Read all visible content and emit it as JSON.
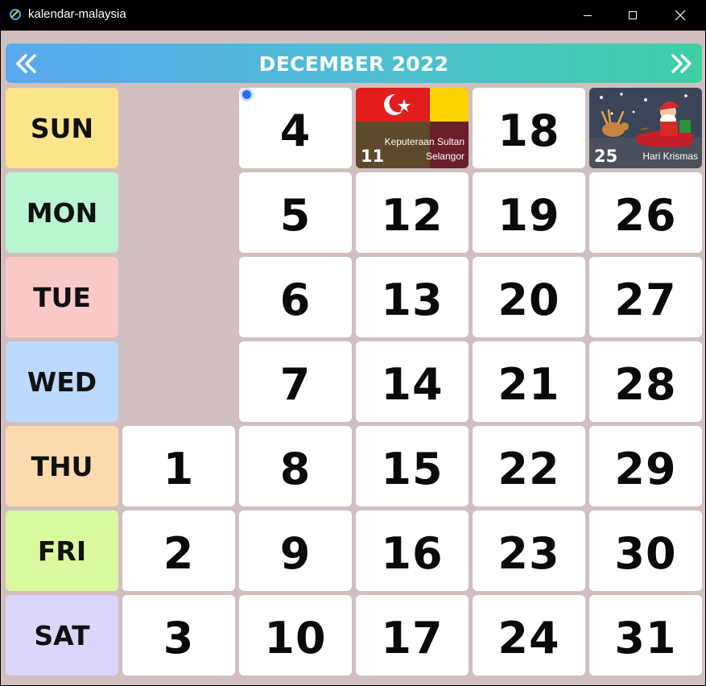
{
  "window": {
    "title": "kalendar-malaysia"
  },
  "header": {
    "month_title": "DECEMBER 2022"
  },
  "days": [
    "SUN",
    "MON",
    "TUE",
    "WED",
    "THU",
    "FRI",
    "SAT"
  ],
  "day_colors": [
    "#fde58c",
    "#b9f5d0",
    "#fcc9c9",
    "#bdd9fd",
    "#fddbae",
    "#daf99f",
    "#dcd6fd"
  ],
  "dates": {
    "thu_1": "1",
    "fri_2": "2",
    "sat_3": "3",
    "sun_4": "4",
    "mon_5": "5",
    "tue_6": "6",
    "wed_7": "7",
    "thu_8": "8",
    "fri_9": "9",
    "sat_10": "10",
    "mon_12": "12",
    "tue_13": "13",
    "wed_14": "14",
    "thu_15": "15",
    "fri_16": "16",
    "sat_17": "17",
    "sun_18": "18",
    "mon_19": "19",
    "tue_20": "20",
    "wed_21": "21",
    "thu_22": "22",
    "fri_23": "23",
    "sat_24": "24",
    "mon_26": "26",
    "tue_27": "27",
    "wed_28": "28",
    "thu_29": "29",
    "fri_30": "30",
    "sat_31": "31"
  },
  "holidays": {
    "sun_11": {
      "day": "11",
      "name": "Keputeraan Sultan Selangor"
    },
    "sun_25": {
      "day": "25",
      "name": "Hari Krismas"
    }
  },
  "colors": {
    "background": "#d1bfc0",
    "header_gradient_start": "#5aa8ee",
    "header_gradient_end": "#3ecfa4",
    "today_marker": "#2c6ff0"
  },
  "icons": {
    "app": "app-logo-icon",
    "prev": "double-chevron-left-icon",
    "next": "double-chevron-right-icon"
  }
}
